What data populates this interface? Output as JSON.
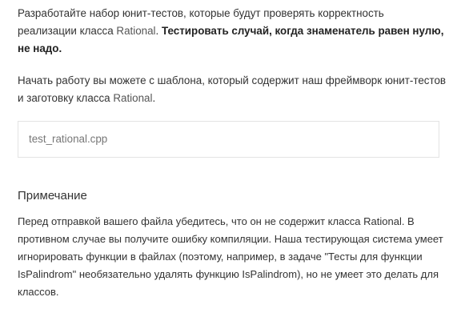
{
  "intro": {
    "text1": "Разработайте набор юнит-тестов, которые будут проверять корректность реализации класса ",
    "class_name": "Rational",
    "text2": ". ",
    "bold": "Тестировать случай, когда знаменатель равен нулю, не надо."
  },
  "template": {
    "text1": "Начать работу вы можете с шаблона, который содержит наш фреймворк юнит-тестов и заготовку класса ",
    "class_name": "Rational",
    "text2": "."
  },
  "file": {
    "name": "test_rational.cpp"
  },
  "note": {
    "title": "Примечание",
    "text": "Перед отправкой вашего файла убедитесь, что он не содержит класса Rational. В противном случае вы получите ошибку компиляции. Наша тестирующая система умеет игнорировать функции в файлах (поэтому, например, в задаче \"Тесты для функции IsPalindrom\" необязательно удалять функцию IsPalindrom), но не умеет это делать для классов."
  }
}
